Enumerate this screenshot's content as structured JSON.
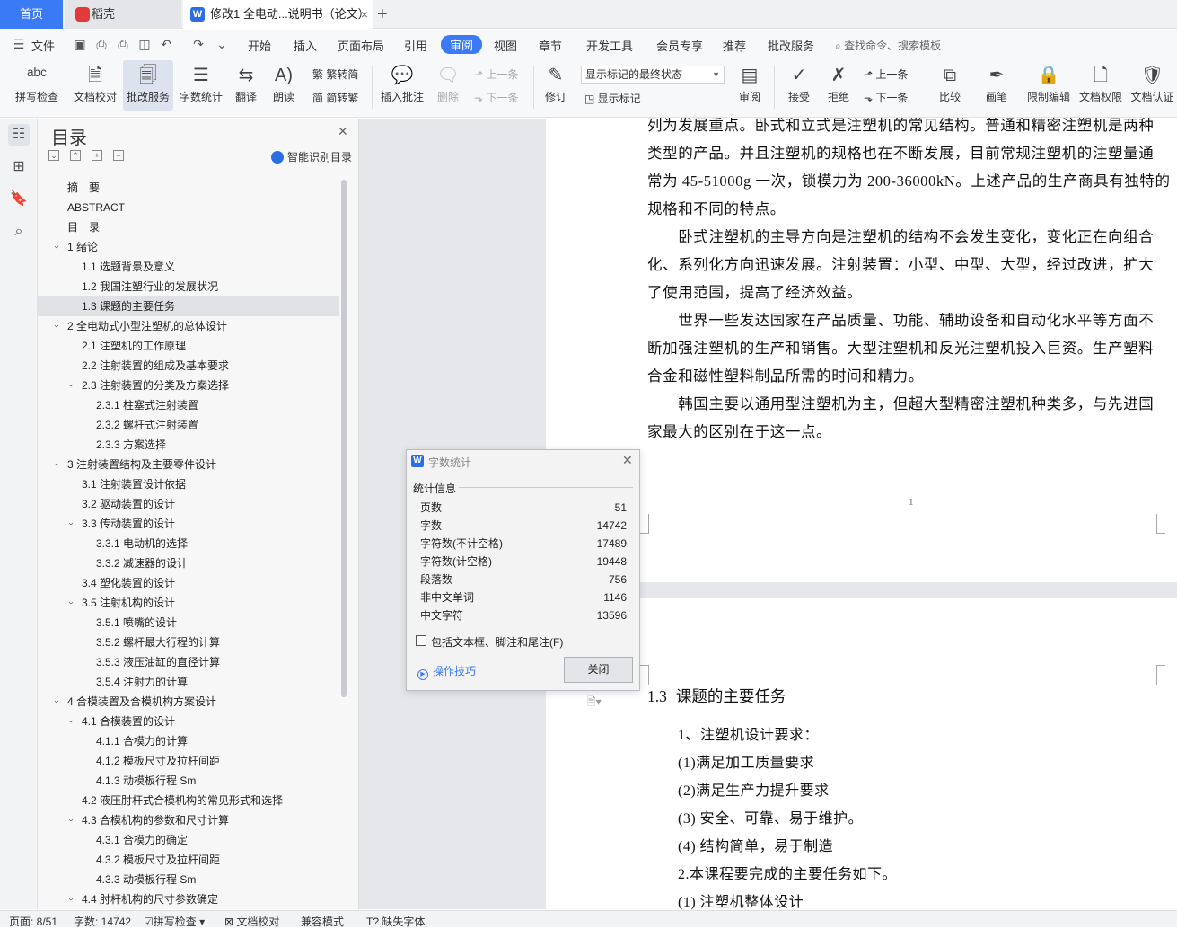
{
  "tabs": {
    "home": "首页",
    "daoke": "稻壳",
    "doc": "修改1 全电动...说明书（论文）",
    "add": "+"
  },
  "menu": {
    "file": "文件",
    "items": [
      "开始",
      "插入",
      "页面布局",
      "引用",
      "审阅",
      "视图",
      "章节",
      "开发工具",
      "会员专享",
      "推荐",
      "批改服务"
    ],
    "active": "审阅",
    "search": "查找命令、搜索模板"
  },
  "ribbon": {
    "spell": "拼写检查",
    "doc_check": "文档校对",
    "review_service": "批改服务",
    "word_count": "字数统计",
    "translate": "翻译",
    "read_aloud": "朗读",
    "trad": "繁转简",
    "simp": "简转繁",
    "insert_comment": "插入批注",
    "delete": "删除",
    "prev": "上一条",
    "next": "下一条",
    "revise": "修订",
    "markup_state": "显示标记的最终状态",
    "show_markup": "显示标记",
    "review": "审阅",
    "accept": "接受",
    "reject": "拒绝",
    "prev2": "上一条",
    "next2": "下一条",
    "compare": "比较",
    "ink": "画笔",
    "restrict": "限制编辑",
    "doc_perm": "文档权限",
    "doc_auth": "文档认证"
  },
  "toc": {
    "title": "目录",
    "smart": "智能识别目录",
    "items": [
      {
        "t": "摘　要"
      },
      {
        "t": "ABSTRACT"
      },
      {
        "t": "目　录"
      },
      {
        "t": "1  绪论"
      },
      {
        "t": "1.1  选题背景及意义"
      },
      {
        "t": "1.2  我国注塑行业的发展状况"
      },
      {
        "t": "1.3  课题的主要任务"
      },
      {
        "t": "2  全电动式小型注塑机的总体设计"
      },
      {
        "t": "2.1 注塑机的工作原理"
      },
      {
        "t": "2.2  注射装置的组成及基本要求"
      },
      {
        "t": "2.3  注射装置的分类及方案选择"
      },
      {
        "t": "2.3.1 柱塞式注射装置"
      },
      {
        "t": "2.3.2 螺杆式注射装置"
      },
      {
        "t": "2.3.3  方案选择"
      },
      {
        "t": "3  注射装置结构及主要零件设计"
      },
      {
        "t": "3.1 注射装置设计依据"
      },
      {
        "t": "3.2  驱动装置的设计"
      },
      {
        "t": "3.3 传动装置的设计"
      },
      {
        "t": "3.3.1 电动机的选择"
      },
      {
        "t": "3.3.2 减速器的设计"
      },
      {
        "t": "3.4 塑化装置的设计"
      },
      {
        "t": "3.5 注射机构的设计"
      },
      {
        "t": "3.5.1 喷嘴的设计"
      },
      {
        "t": "3.5.2 螺杆最大行程的计算"
      },
      {
        "t": "3.5.3 液压油缸的直径计算"
      },
      {
        "t": "3.5.4 注射力的计算"
      },
      {
        "t": "4  合模装置及合模机构方案设计"
      },
      {
        "t": "4.1  合模装置的设计"
      },
      {
        "t": "4.1.1 合模力的计算"
      },
      {
        "t": "4.1.2 模板尺寸及拉杆间距"
      },
      {
        "t": "4.1.3 动模板行程 Sm"
      },
      {
        "t": "4.2  液压肘杆式合模机构的常见形式和选择"
      },
      {
        "t": "4.3 合模机构的参数和尺寸计算"
      },
      {
        "t": "4.3.1 合模力的确定"
      },
      {
        "t": "4.3.2  模板尺寸及拉杆间距"
      },
      {
        "t": "4.3.3  动模板行程 Sm"
      },
      {
        "t": "4.4  肘杆机构的尺寸参数确定"
      }
    ]
  },
  "doc": {
    "p1": [
      "列为发展重点。卧式和立式是注塑机的常见结构。普通和精密注塑机是两种",
      "类型的产品。并且注塑机的规格也在不断发展，目前常规注塑机的注塑量通",
      "常为 45-51000g 一次，锁模力为 200-36000kN。上述产品的生产商具有独特的",
      "规格和不同的特点。",
      "　　卧式注塑机的主导方向是注塑机的结构不会发生变化，变化正在向组合",
      "化、系列化方向迅速发展。注射装置：小型、中型、大型，经过改进，扩大",
      "了使用范围，提高了经济效益。",
      "　　世界一些发达国家在产品质量、功能、辅助设备和自动化水平等方面不",
      "断加强注塑机的生产和销售。大型注塑机和反光注塑机投入巨资。生产塑料",
      "合金和磁性塑料制品所需的时间和精力。",
      "　　韩国主要以通用型注塑机为主，但超大型精密注塑机种类多，与先进国",
      "家最大的区别在于这一点。"
    ],
    "page_number": "1",
    "heading_num": "1.3",
    "heading": "课题的主要任务",
    "tasks": [
      "1、注塑机设计要求：",
      "(1)满足加工质量要求",
      "(2)满足生产力提升要求",
      "(3)  安全、可靠、易于维护。",
      "(4)  结构简单，易于制造",
      "2.本课程要完成的主要任务如下。",
      "(1)  注塑机整体设计"
    ]
  },
  "dialog": {
    "title": "字数统计",
    "section": "统计信息",
    "rows": [
      {
        "k": "页数",
        "v": "51"
      },
      {
        "k": "字数",
        "v": "14742"
      },
      {
        "k": "字符数(不计空格)",
        "v": "17489"
      },
      {
        "k": "字符数(计空格)",
        "v": "19448"
      },
      {
        "k": "段落数",
        "v": "756"
      },
      {
        "k": "非中文单词",
        "v": "1146"
      },
      {
        "k": "中文字符",
        "v": "13596"
      }
    ],
    "checkbox": "包括文本框、脚注和尾注(F)",
    "tips": "操作技巧",
    "close": "关闭"
  },
  "status": {
    "page": "页面: 8/51",
    "words": "字数: 14742",
    "spell": "拼写检查",
    "doc_check": "文档校对",
    "compat": "兼容模式",
    "missing_font": "缺失字体"
  },
  "colors": {
    "accent": "#3a7af5",
    "selected": "#dfe1e5"
  }
}
